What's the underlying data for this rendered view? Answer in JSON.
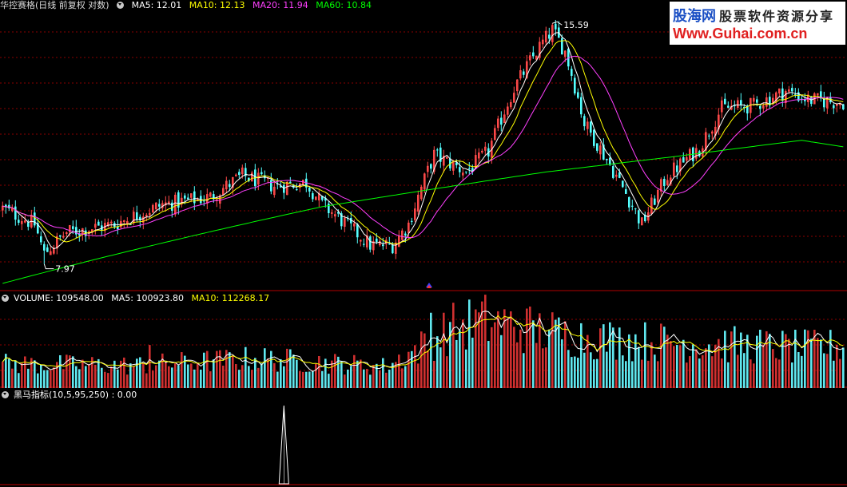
{
  "price_panel": {
    "stock_name": "华控赛格",
    "period": "(日线 前复权 对数)",
    "ma5_label": "MA5: 12.01",
    "ma10_label": "MA10: 12.13",
    "ma20_label": "MA20: 11.94",
    "ma60_label": "MA60: 10.84",
    "high_label": "15.59",
    "low_label": "7.97"
  },
  "volume_panel": {
    "volume_label": "VOLUME: 109548.00",
    "ma5_label": "MA5: 100923.80",
    "ma10_label": "MA10: 112268.17"
  },
  "indicator_panel": {
    "name_label": "黑马指标(10,5,95,250)",
    "value_label": ": 0.00"
  },
  "watermark": {
    "brand": "股海网",
    "slogan": "股票软件资源分享",
    "url": "Www.Guhai.com.cn"
  },
  "colors": {
    "up": "#ff4a4a",
    "down": "#54ffff",
    "ma5": "#ffffff",
    "ma10": "#ffff00",
    "ma20": "#ff40ff",
    "ma60": "#00ff00",
    "grid": "#8b0000"
  },
  "chart_data": {
    "type": "candlestick",
    "price_range": [
      7.6,
      16.2
    ],
    "highest": 15.59,
    "lowest": 7.97,
    "current": {
      "MA5": 12.01,
      "MA10": 12.13,
      "MA20": 11.94,
      "MA60": 10.84
    },
    "volume_current": {
      "VOLUME": 109548.0,
      "MA5": 100923.8,
      "MA10": 112268.17
    },
    "close_keypoints": [
      [
        0,
        9.3
      ],
      [
        10,
        8.9
      ],
      [
        13,
        8.2
      ],
      [
        20,
        8.7
      ],
      [
        35,
        8.9
      ],
      [
        50,
        9.4
      ],
      [
        65,
        9.6
      ],
      [
        75,
        10.2
      ],
      [
        85,
        9.9
      ],
      [
        95,
        10.0
      ],
      [
        100,
        9.4
      ],
      [
        115,
        8.4
      ],
      [
        122,
        8.4
      ],
      [
        127,
        8.9
      ],
      [
        135,
        10.8
      ],
      [
        145,
        10.3
      ],
      [
        152,
        10.9
      ],
      [
        160,
        13.0
      ],
      [
        168,
        14.6
      ],
      [
        172,
        15.3
      ],
      [
        176,
        14.4
      ],
      [
        182,
        11.8
      ],
      [
        190,
        10.5
      ],
      [
        200,
        8.9
      ],
      [
        208,
        10.2
      ],
      [
        218,
        11.0
      ],
      [
        225,
        12.3
      ],
      [
        235,
        12.4
      ],
      [
        245,
        12.9
      ],
      [
        252,
        12.6
      ],
      [
        263,
        12.5
      ]
    ],
    "volume_keypoints": [
      [
        0,
        45000
      ],
      [
        40,
        42000
      ],
      [
        80,
        55000
      ],
      [
        120,
        40000
      ],
      [
        132,
        80000
      ],
      [
        140,
        110000
      ],
      [
        150,
        125000
      ],
      [
        160,
        115000
      ],
      [
        175,
        100000
      ],
      [
        190,
        90000
      ],
      [
        210,
        85000
      ],
      [
        230,
        80000
      ],
      [
        250,
        75000
      ],
      [
        263,
        78000
      ]
    ],
    "indicator_signal": {
      "bar_index": 88,
      "value": 1
    },
    "indicator_value": 0.0
  }
}
